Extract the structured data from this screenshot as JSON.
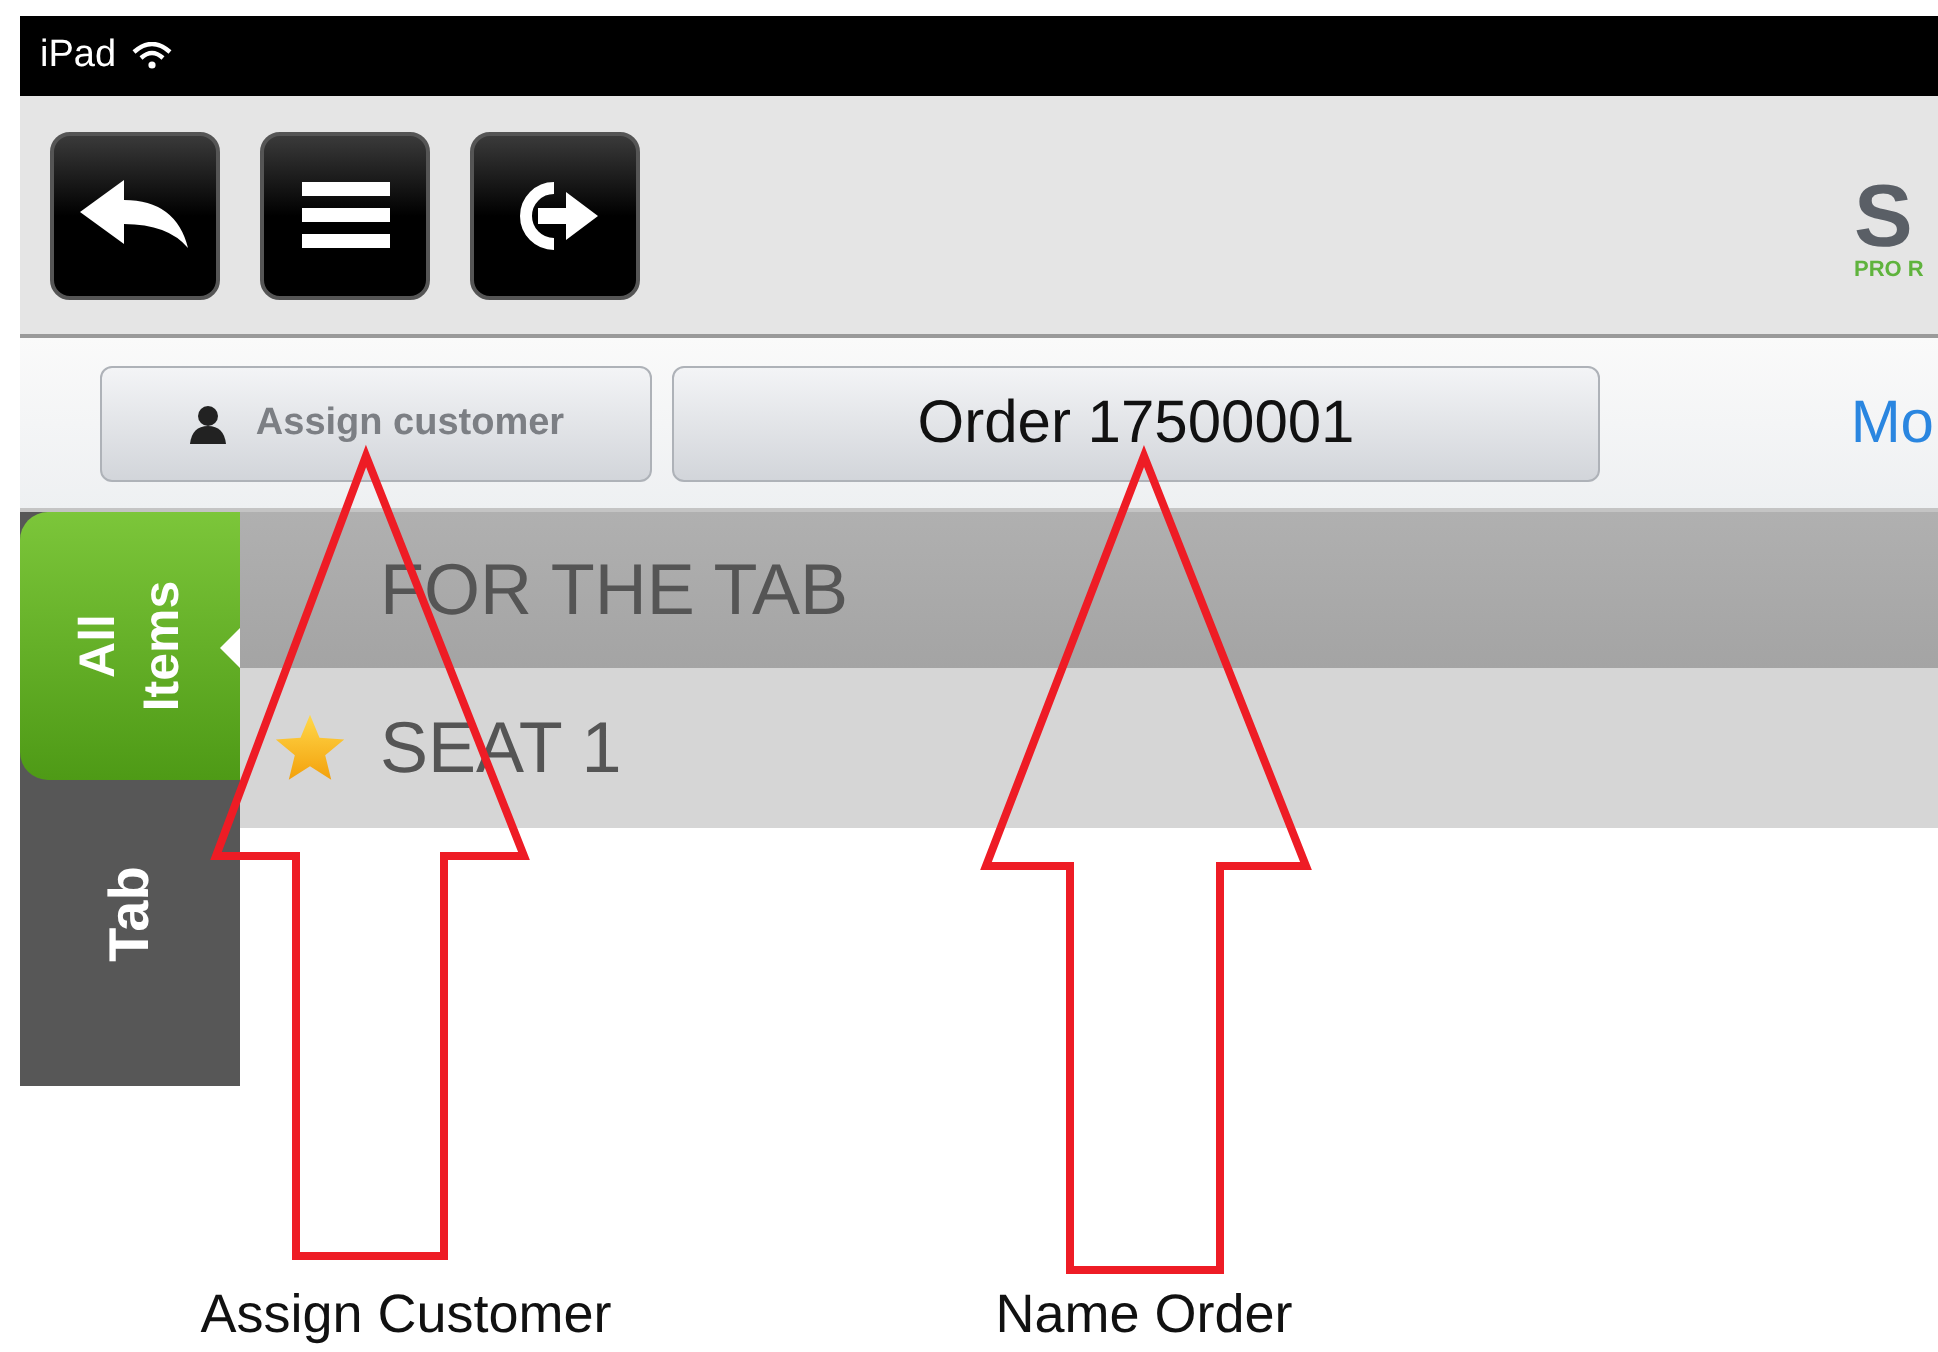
{
  "status_bar": {
    "carrier": "iPad"
  },
  "toolbar": {
    "buttons": [
      {
        "kind": "back"
      },
      {
        "kind": "menu"
      },
      {
        "kind": "logout"
      }
    ],
    "logo": {
      "mark": "S",
      "tagline": "PRO R"
    }
  },
  "order_bar": {
    "customer_button": "Assign customer",
    "order_title": "Order 17500001",
    "link": "Mo"
  },
  "side_tabs": [
    {
      "label": "All Items",
      "selected": true
    },
    {
      "label": "Tab",
      "selected": false
    }
  ],
  "sections": [
    {
      "title": "FOR THE TAB",
      "kind": "group",
      "starred": false
    },
    {
      "title": "SEAT 1",
      "kind": "seat",
      "starred": true
    }
  ],
  "annotations": [
    {
      "label": "Assign Customer"
    },
    {
      "label": "Name Order"
    }
  ]
}
